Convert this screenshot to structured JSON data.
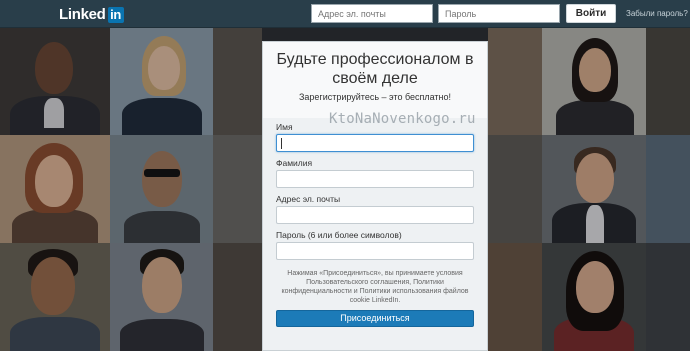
{
  "header": {
    "logo_text": "Linked",
    "logo_in": "in",
    "email_placeholder": "Адрес эл. почты",
    "password_placeholder": "Пароль",
    "login_label": "Войти",
    "forgot_label": "Забыли пароль?"
  },
  "signup": {
    "title": "Будьте профессионалом в своём деле",
    "subtitle": "Зарегистрируйтесь – это бесплатно!",
    "first_name_label": "Имя",
    "last_name_label": "Фамилия",
    "email_label": "Адрес эл. почты",
    "password_label": "Пароль (6 или более символов)",
    "terms_text": "Нажимая «Присоединиться», вы принимаете условия Пользовательского соглашения, Политики конфиденциальности и Политики использования файлов cookie LinkedIn.",
    "join_label": "Присоединиться"
  },
  "watermark": "KtoNaNovenkogo.ru",
  "colors": {
    "header_bg": "#293e4a",
    "brand_blue": "#0a74b0",
    "join_button": "#1c7bb8",
    "card_bg": "#eef1f3"
  }
}
